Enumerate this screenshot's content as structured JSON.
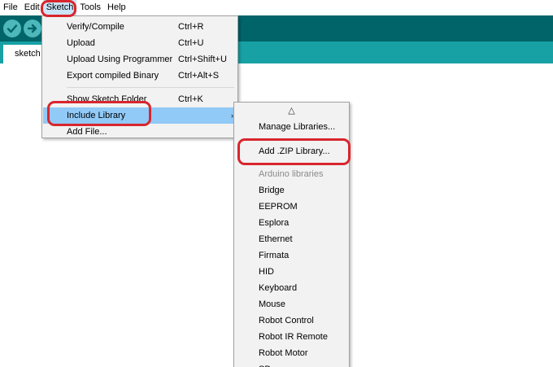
{
  "menubar": {
    "items": [
      "File",
      "Edit",
      "Sketch",
      "Tools",
      "Help"
    ]
  },
  "toolbar": {
    "verify_icon": "checkmark-icon",
    "upload_icon": "arrow-right-icon"
  },
  "tabs": [
    {
      "label": "sketch"
    }
  ],
  "sketch_menu": {
    "items": [
      {
        "label": "Verify/Compile",
        "shortcut": "Ctrl+R"
      },
      {
        "label": "Upload",
        "shortcut": "Ctrl+U"
      },
      {
        "label": "Upload Using Programmer",
        "shortcut": "Ctrl+Shift+U"
      },
      {
        "label": "Export compiled Binary",
        "shortcut": "Ctrl+Alt+S"
      },
      {
        "label": "Show Sketch Folder",
        "shortcut": "Ctrl+K"
      },
      {
        "label": "Include Library",
        "shortcut": ""
      },
      {
        "label": "Add File...",
        "shortcut": ""
      }
    ],
    "submenu_arrow": "›"
  },
  "include_library_menu": {
    "scroll_up": "△",
    "manage": "Manage Libraries...",
    "add_zip": "Add .ZIP Library...",
    "section_header": "Arduino libraries",
    "libraries": [
      "Bridge",
      "EEPROM",
      "Esplora",
      "Ethernet",
      "Firmata",
      "HID",
      "Keyboard",
      "Mouse",
      "Robot Control",
      "Robot IR Remote",
      "Robot Motor",
      "SD"
    ]
  },
  "colors": {
    "toolbar": "#006468",
    "tabstrip": "#17a1a5",
    "button": "#4db7bb",
    "highlight": "#91c9f7",
    "callout": "#d8262c"
  }
}
